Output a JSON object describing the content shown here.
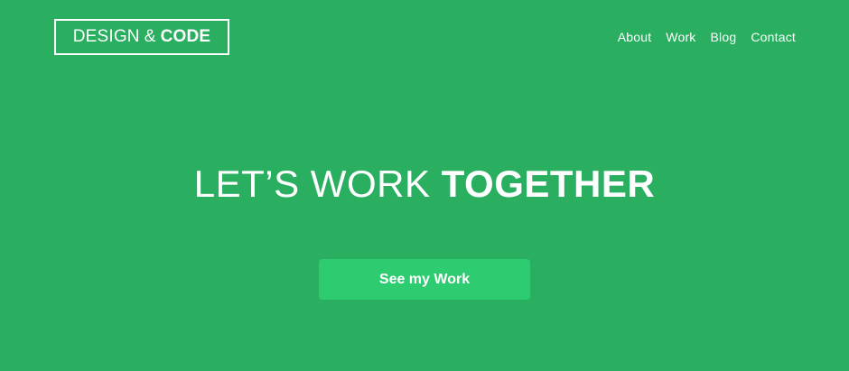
{
  "brand": {
    "part1": "DESIGN",
    "amp": "&",
    "part2": "CODE"
  },
  "nav": {
    "items": [
      "About",
      "Work",
      "Blog",
      "Contact"
    ]
  },
  "hero": {
    "title_light": "LET’S WORK",
    "title_bold": "TOGETHER",
    "cta_label": "See my Work"
  },
  "colors": {
    "background": "#2aaf61",
    "button": "#2ecc71",
    "text": "#ffffff"
  }
}
